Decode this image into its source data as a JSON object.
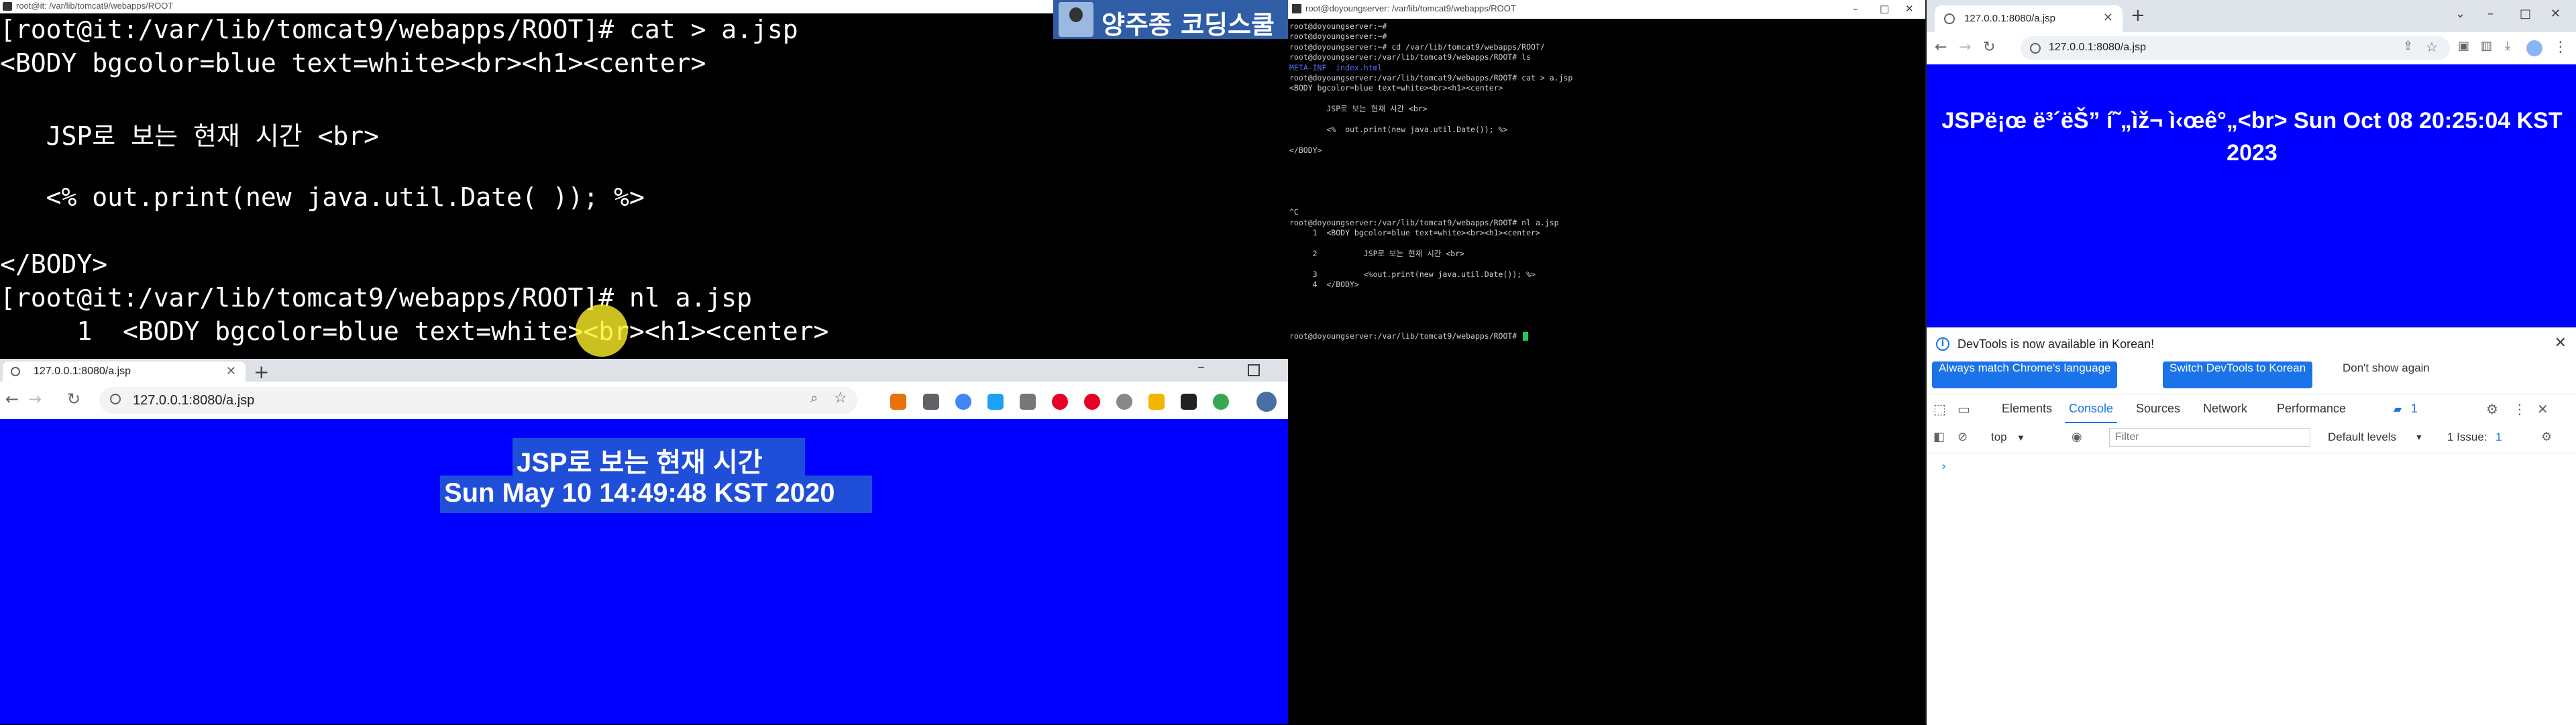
{
  "left_terminal": {
    "title": "root@it: /var/lib/tomcat9/webapps/ROOT",
    "lines": [
      "[root@it:/var/lib/tomcat9/webapps/ROOT]# cat > a.jsp",
      "<BODY bgcolor=blue text=white><br><h1><center>",
      "",
      "   JSP로 보는 현재 시간 <br>",
      "",
      "   <% out.print(new java.util.Date( )); %>",
      "",
      "</BODY>",
      "[root@it:/var/lib/tomcat9/webapps/ROOT]# nl a.jsp",
      "     1  <BODY bgcolor=blue text=white><br><h1><center>"
    ],
    "banner_text": "양주종 코딩스쿨"
  },
  "left_browser": {
    "tab_title": "127.0.0.1:8080/a.jsp",
    "new_tab": "+",
    "url": "127.0.0.1:8080/a.jsp",
    "page_line1": "JSP로 보는 현재 시간",
    "page_line2": "Sun May 10 14:49:48 KST 2020",
    "colors": {
      "page_bg": "#0000ff",
      "selection": "#1f4fd8",
      "ext1": "#ea4335",
      "ext2": "#5f6368",
      "ext3": "#4285f4",
      "ext4": "#e60023",
      "ext5": "#34a853"
    }
  },
  "middle_terminal": {
    "title": "root@doyoungserver: /var/lib/tomcat9/webapps/ROOT",
    "lines": [
      "root@doyoungserver:~#",
      "root@doyoungserver:~#",
      "root@doyoungserver:~# cd /var/lib/tomcat9/webapps/ROOT/",
      "root@doyoungserver:/var/lib/tomcat9/webapps/ROOT# ls",
      "META-INF  index.html",
      "root@doyoungserver:/var/lib/tomcat9/webapps/ROOT# cat > a.jsp",
      "<BODY bgcolor=blue text=white><br><h1><center>",
      "",
      "        JSP로 보는 현재 시간 <br>",
      "",
      "        <%  out.print(new java.util.Date()); %>",
      "",
      "</BODY>",
      "",
      "",
      "",
      "",
      "",
      "^C",
      "root@doyoungserver:/var/lib/tomcat9/webapps/ROOT# nl a.jsp",
      "     1  <BODY bgcolor=blue text=white><br><h1><center>",
      "",
      "     2          JSP로 보는 현재 시간 <br>",
      "",
      "     3          <%out.print(new java.util.Date()); %>",
      "     4  </BODY>",
      "",
      "",
      "",
      "",
      "root@doyoungserver:/var/lib/tomcat9/webapps/ROOT# "
    ]
  },
  "right_browser": {
    "tab_title": "127.0.0.1:8080/a.jsp",
    "new_tab": "+",
    "url": "127.0.0.1:8080/a.jsp",
    "heading": "JSPë¡œ ë³´ëŠ” í˜„ìž¬ ì‹œê°„<br> Sun Oct 08 20:25:04 KST 2023",
    "devtools": {
      "notice": "DevTools is now available in Korean!",
      "btn_match": "Always match Chrome's language",
      "btn_switch": "Switch DevTools to Korean",
      "btn_dont": "Don't show again",
      "tabs": [
        "Elements",
        "Console",
        "Sources",
        "Network",
        "Performance"
      ],
      "badge_count": "1",
      "context": "top",
      "filter_placeholder": "Filter",
      "levels": "Default levels",
      "issues": "1 Issue:",
      "issues_count": "1",
      "prompt": "›"
    }
  }
}
